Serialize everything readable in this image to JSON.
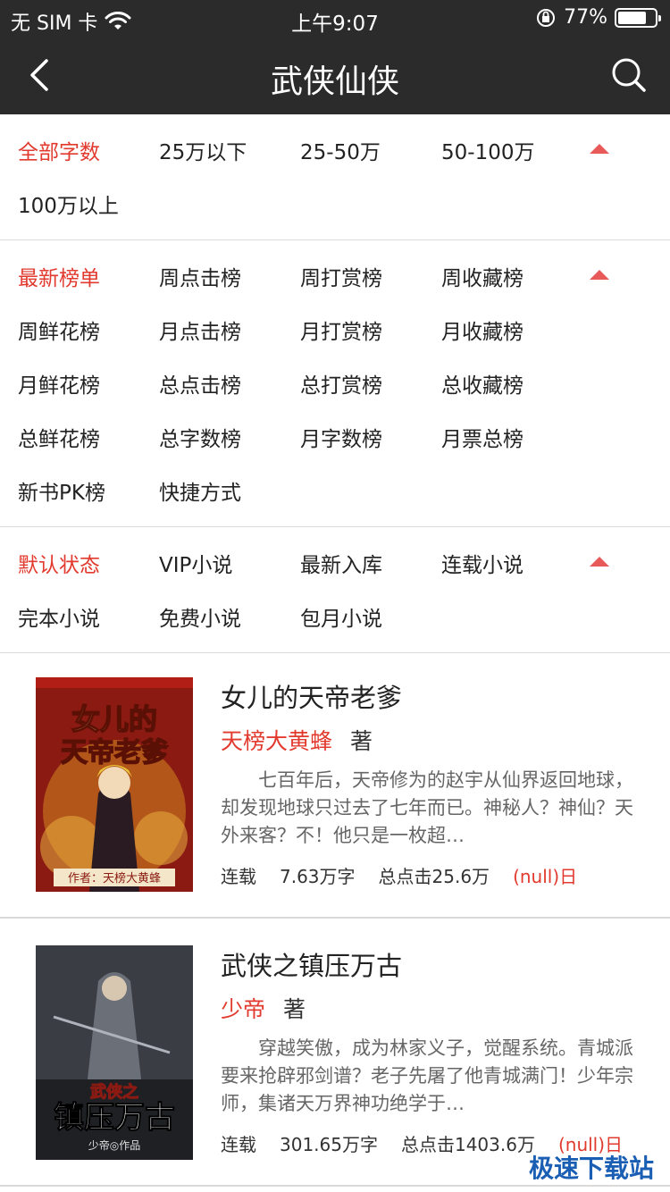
{
  "status_bar": {
    "carrier": "无 SIM 卡",
    "time": "上午9:07",
    "battery_text": "77%",
    "battery_level": 0.77
  },
  "nav": {
    "title": "武侠仙侠"
  },
  "filters": {
    "word_count": [
      "全部字数",
      "25万以下",
      "25-50万",
      "50-100万",
      "100万以上"
    ],
    "ranking": [
      "最新榜单",
      "周点击榜",
      "周打赏榜",
      "周收藏榜",
      "周鲜花榜",
      "月点击榜",
      "月打赏榜",
      "月收藏榜",
      "月鲜花榜",
      "总点击榜",
      "总打赏榜",
      "总收藏榜",
      "总鲜花榜",
      "总字数榜",
      "月字数榜",
      "月票总榜",
      "新书PK榜",
      "快捷方式"
    ],
    "status": [
      "默认状态",
      "VIP小说",
      "最新入库",
      "连载小说",
      "完本小说",
      "免费小说",
      "包月小说"
    ]
  },
  "books": [
    {
      "title": "女儿的天帝老爹",
      "author": "天榜大黄蜂",
      "author_suffix": "著",
      "intro": "七百年后，天帝修为的赵宇从仙界返回地球，却发现地球只过去了七年而已。神秘人？神仙？天外来客？不！他只是一枚超…",
      "status": "连载",
      "words": "7.63万字",
      "clicks": "总点击25.6万",
      "date": "(null)日",
      "cover_title_1": "女儿的",
      "cover_title_2": "天帝老爹",
      "cover_author": "作者：天榜大黄蜂"
    },
    {
      "title": "武侠之镇压万古",
      "author": "少帝",
      "author_suffix": "著",
      "intro": "穿越笑傲，成为林家义子，觉醒系统。青城派要来抢辟邪剑谱？老子先屠了他青城满门！少年宗师，集诸天万界神功绝学于…",
      "status": "连载",
      "words": "301.65万字",
      "clicks": "总点击1403.6万",
      "date": "(null)日",
      "cover_title_1": "武侠之",
      "cover_title_2": "镇压万古",
      "cover_author": "少帝◎作品"
    }
  ],
  "watermark": "极速下载站",
  "colors": {
    "accent": "#e23a2e",
    "caret": "#e85a5a",
    "topbar": "#2b2b2b"
  }
}
